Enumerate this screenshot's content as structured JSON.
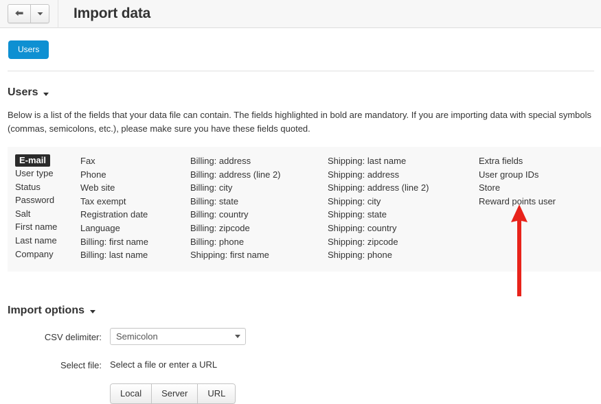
{
  "header": {
    "title": "Import data",
    "back_icon": "back-arrow-icon",
    "dropdown_icon": "chevron-down-icon"
  },
  "tabs": [
    {
      "label": "Users",
      "active": true
    }
  ],
  "section": {
    "heading": "Users",
    "caret_icon": "caret-down-icon",
    "description": "Below is a list of the fields that your data file can contain. The fields highlighted in bold are mandatory. If you are importing data with special symbols (commas, semicolons, etc.), please make sure you have these fields quoted."
  },
  "fields": {
    "columns": [
      {
        "items": [
          {
            "label": "E-mail",
            "mandatory": true
          },
          {
            "label": "User type",
            "mandatory": false
          },
          {
            "label": "Status",
            "mandatory": false
          },
          {
            "label": "Password",
            "mandatory": false
          },
          {
            "label": "Salt",
            "mandatory": false
          },
          {
            "label": "First name",
            "mandatory": false
          },
          {
            "label": "Last name",
            "mandatory": false
          },
          {
            "label": "Company",
            "mandatory": false
          }
        ]
      },
      {
        "items": [
          {
            "label": "Fax",
            "mandatory": false
          },
          {
            "label": "Phone",
            "mandatory": false
          },
          {
            "label": "Web site",
            "mandatory": false
          },
          {
            "label": "Tax exempt",
            "mandatory": false
          },
          {
            "label": "Registration date",
            "mandatory": false
          },
          {
            "label": "Language",
            "mandatory": false
          },
          {
            "label": "Billing: first name",
            "mandatory": false
          },
          {
            "label": "Billing: last name",
            "mandatory": false
          }
        ]
      },
      {
        "items": [
          {
            "label": "Billing: address",
            "mandatory": false
          },
          {
            "label": "Billing: address (line 2)",
            "mandatory": false
          },
          {
            "label": "Billing: city",
            "mandatory": false
          },
          {
            "label": "Billing: state",
            "mandatory": false
          },
          {
            "label": "Billing: country",
            "mandatory": false
          },
          {
            "label": "Billing: zipcode",
            "mandatory": false
          },
          {
            "label": "Billing: phone",
            "mandatory": false
          },
          {
            "label": "Shipping: first name",
            "mandatory": false
          }
        ]
      },
      {
        "items": [
          {
            "label": "Shipping: last name",
            "mandatory": false
          },
          {
            "label": "Shipping: address",
            "mandatory": false
          },
          {
            "label": "Shipping: address (line 2)",
            "mandatory": false
          },
          {
            "label": "Shipping: city",
            "mandatory": false
          },
          {
            "label": "Shipping: state",
            "mandatory": false
          },
          {
            "label": "Shipping: country",
            "mandatory": false
          },
          {
            "label": "Shipping: zipcode",
            "mandatory": false
          },
          {
            "label": "Shipping: phone",
            "mandatory": false
          }
        ]
      },
      {
        "items": [
          {
            "label": "Extra fields",
            "mandatory": false
          },
          {
            "label": "User group IDs",
            "mandatory": false
          },
          {
            "label": "Store",
            "mandatory": false
          },
          {
            "label": "Reward points user",
            "mandatory": false
          }
        ]
      }
    ]
  },
  "annotation": {
    "icon": "red-up-arrow-annotation",
    "color": "#e8231b",
    "points_at": "Reward points user"
  },
  "import_options": {
    "heading": "Import options",
    "caret_icon": "caret-down-icon",
    "csv_delimiter": {
      "label": "CSV delimiter:",
      "value": "Semicolon",
      "caret_icon": "select-caret-icon"
    },
    "select_file": {
      "label": "Select file:",
      "value": "Select a file or enter a URL",
      "buttons": [
        {
          "label": "Local"
        },
        {
          "label": "Server"
        },
        {
          "label": "URL"
        }
      ]
    }
  },
  "colors": {
    "accent": "#0e90d2",
    "annotation_red": "#e8231b",
    "panel_bg": "#f8f8f8",
    "mandatory_bg": "#2b2b2b"
  }
}
